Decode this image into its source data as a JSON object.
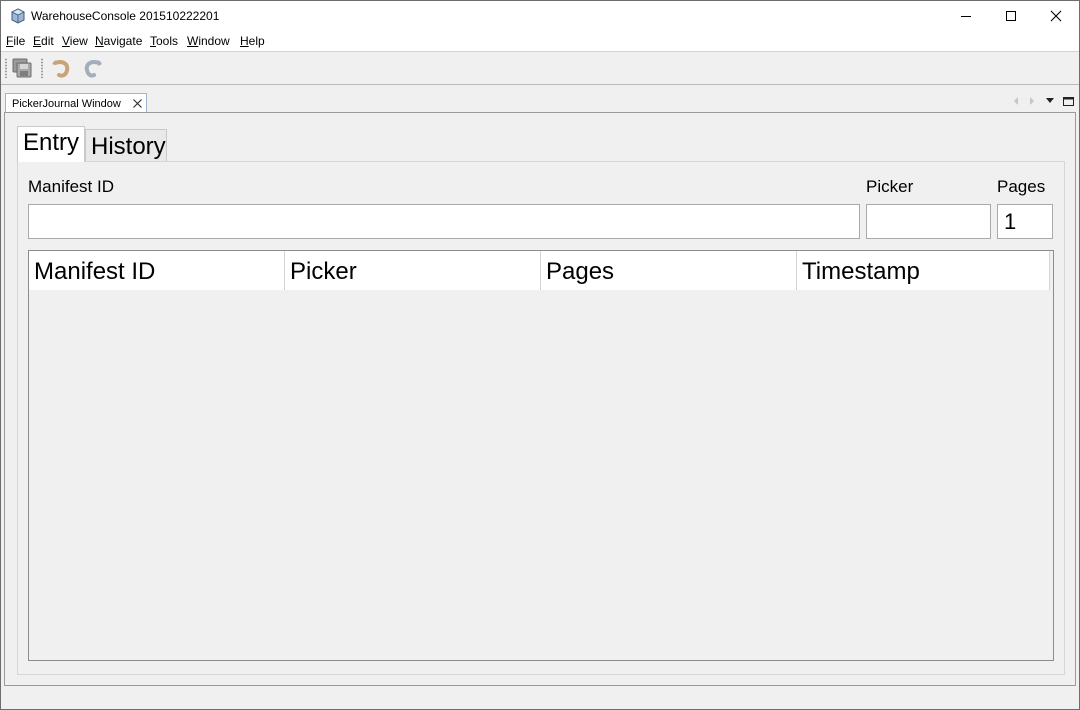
{
  "window": {
    "title": "WarehouseConsole 201510222201"
  },
  "menu": [
    {
      "label": "File",
      "mnemonic": "F",
      "rest": "ile"
    },
    {
      "label": "Edit",
      "mnemonic": "E",
      "rest": "dit"
    },
    {
      "label": "View",
      "mnemonic": "V",
      "rest": "iew"
    },
    {
      "label": "Navigate",
      "mnemonic": "N",
      "rest": "avigate"
    },
    {
      "label": "Tools",
      "mnemonic": "T",
      "rest": "ools"
    },
    {
      "label": "Window",
      "mnemonic": "W",
      "rest": "indow"
    },
    {
      "label": "Help",
      "mnemonic": "H",
      "rest": "elp"
    }
  ],
  "toolbar": {
    "icons": [
      "save-all-icon",
      "undo-icon",
      "redo-icon"
    ]
  },
  "document_tab": {
    "label": "PickerJournal Window"
  },
  "tabs": [
    {
      "label": "Entry",
      "selected": true
    },
    {
      "label": "History",
      "selected": false
    }
  ],
  "form": {
    "manifest_label": "Manifest ID",
    "manifest_value": "",
    "picker_label": "Picker",
    "picker_value": "",
    "pages_label": "Pages",
    "pages_value": "1"
  },
  "table": {
    "columns": [
      "Manifest ID",
      "Picker",
      "Pages",
      "Timestamp"
    ],
    "rows": []
  },
  "colors": {
    "window_bg": "#f0f0f0",
    "titlebar_bg": "#ffffff",
    "tab_border": "#9db5d1"
  }
}
